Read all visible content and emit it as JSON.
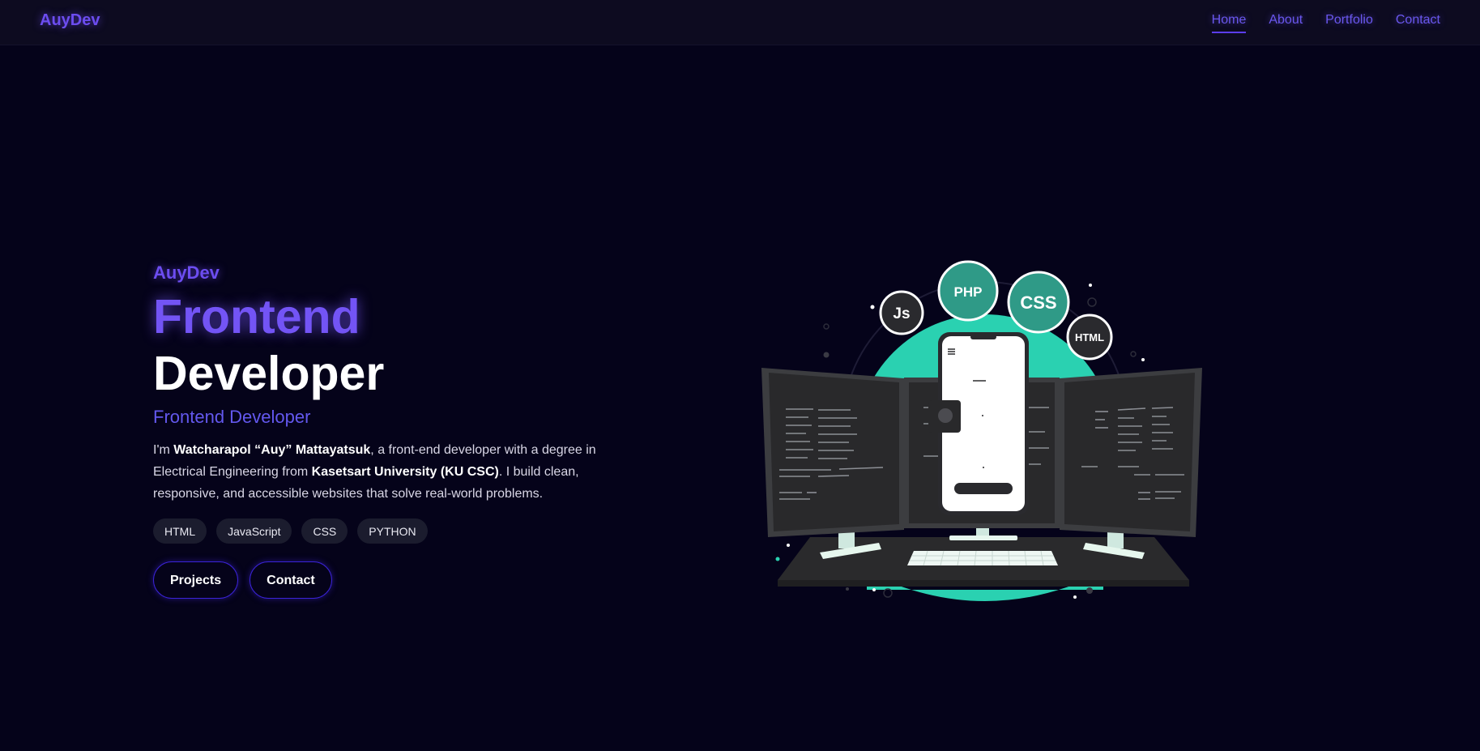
{
  "nav": {
    "brand": "AuyDev",
    "links": [
      {
        "label": "Home",
        "active": true
      },
      {
        "label": "About",
        "active": false
      },
      {
        "label": "Portfolio",
        "active": false
      },
      {
        "label": "Contact",
        "active": false
      }
    ]
  },
  "hero": {
    "brand": "AuyDev",
    "title_line1": "Frontend",
    "title_line2": "Developer",
    "subtitle": "Frontend Developer",
    "bio": {
      "p1": "I'm ",
      "name": "Watcharapol “Auy” Mattayatsuk",
      "p2": ", a front-end developer with a degree in Electrical Engineering from ",
      "school": "Kasetsart University (KU CSC)",
      "p3": ". I build clean, responsive, and accessible websites that solve real-world problems."
    },
    "tags": [
      "HTML",
      "JavaScript",
      "CSS",
      "PYTHON"
    ],
    "buttons": {
      "projects": "Projects",
      "contact": "Contact"
    }
  },
  "illustration": {
    "badges": {
      "js": "Js",
      "php": "PHP",
      "css": "CSS",
      "html": "HTML"
    }
  },
  "colors": {
    "background": "#05031a",
    "navbar": "#0d0b20",
    "accent_purple": "#6c4df0",
    "teal": "#2ad1b1",
    "badge_teal": "#2f9a87",
    "badge_dark": "#2a2a2e"
  }
}
